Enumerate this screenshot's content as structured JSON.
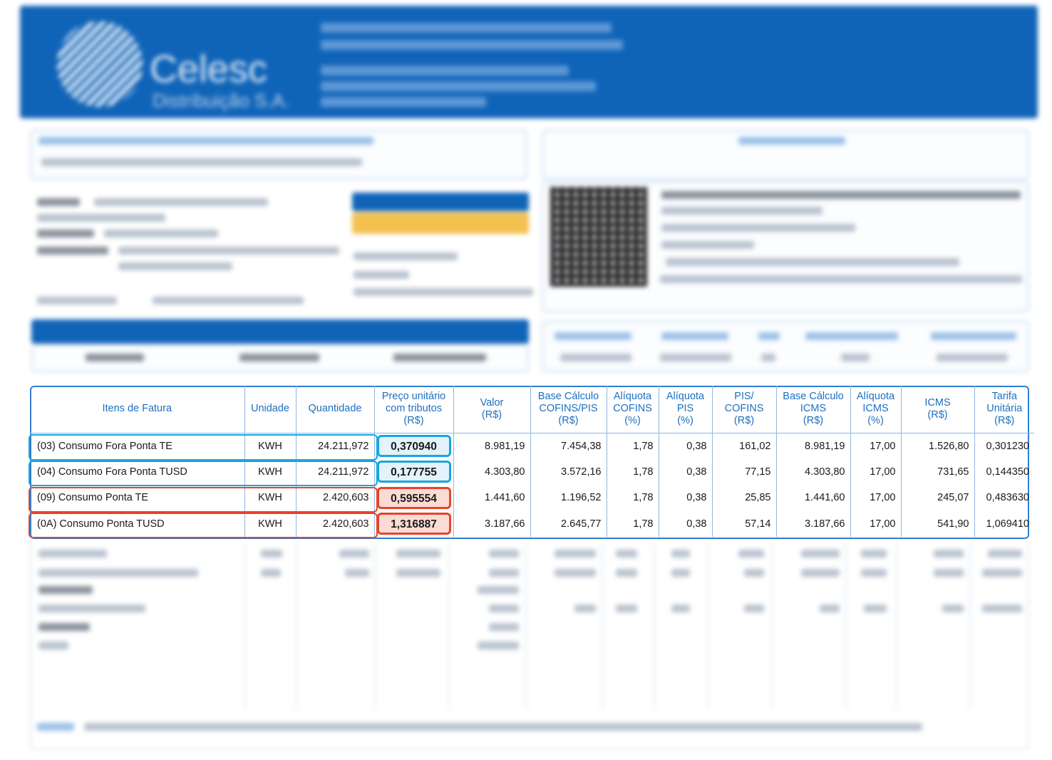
{
  "header": {
    "logo_name": "Celesc",
    "logo_subtitle": "Distribuição S.A."
  },
  "table": {
    "columns": [
      {
        "key": "item",
        "lines": [
          "Itens de Fatura"
        ]
      },
      {
        "key": "unidade",
        "lines": [
          "Unidade"
        ]
      },
      {
        "key": "quantidade",
        "lines": [
          "Quantidade"
        ]
      },
      {
        "key": "preco",
        "lines": [
          "Preço unitário",
          "com tributos",
          "(R$)"
        ]
      },
      {
        "key": "valor",
        "lines": [
          "Valor",
          "(R$)"
        ]
      },
      {
        "key": "base_cofins",
        "lines": [
          "Base Cálculo",
          "COFINS/PIS",
          "(R$)"
        ]
      },
      {
        "key": "aliq_cofins",
        "lines": [
          "Alíquota",
          "COFINS",
          "(%)"
        ]
      },
      {
        "key": "aliq_pis",
        "lines": [
          "Alíquota",
          "PIS",
          "(%)"
        ]
      },
      {
        "key": "pis_cofins",
        "lines": [
          "PIS/",
          "COFINS",
          "(R$)"
        ]
      },
      {
        "key": "base_icms",
        "lines": [
          "Base Cálculo",
          "ICMS",
          "(R$)"
        ]
      },
      {
        "key": "aliq_icms",
        "lines": [
          "Alíquota",
          "ICMS",
          "(%)"
        ]
      },
      {
        "key": "icms",
        "lines": [
          "ICMS",
          "(R$)"
        ]
      },
      {
        "key": "tarifa",
        "lines": [
          "Tarifa",
          "Unitária",
          "(R$)"
        ]
      }
    ],
    "rows": [
      {
        "item": "(03) Consumo Fora Ponta TE",
        "unidade": "KWH",
        "quantidade": "24.211,972",
        "preco": "0,370940",
        "valor": "8.981,19",
        "base_cofins": "7.454,38",
        "aliq_cofins": "1,78",
        "aliq_pis": "0,38",
        "pis_cofins": "161,02",
        "base_icms": "8.981,19",
        "aliq_icms": "17,00",
        "icms": "1.526,80",
        "tarifa": "0,301230",
        "highlight": "blue"
      },
      {
        "item": "(04) Consumo Fora Ponta TUSD",
        "unidade": "KWH",
        "quantidade": "24.211,972",
        "preco": "0,177755",
        "valor": "4.303,80",
        "base_cofins": "3.572,16",
        "aliq_cofins": "1,78",
        "aliq_pis": "0,38",
        "pis_cofins": "77,15",
        "base_icms": "4.303,80",
        "aliq_icms": "17,00",
        "icms": "731,65",
        "tarifa": "0,144350",
        "highlight": "blue"
      },
      {
        "item": "(09) Consumo Ponta TE",
        "unidade": "KWH",
        "quantidade": "2.420,603",
        "preco": "0,595554",
        "valor": "1.441,60",
        "base_cofins": "1.196,52",
        "aliq_cofins": "1,78",
        "aliq_pis": "0,38",
        "pis_cofins": "25,85",
        "base_icms": "1.441,60",
        "aliq_icms": "17,00",
        "icms": "245,07",
        "tarifa": "0,483630",
        "highlight": "red"
      },
      {
        "item": "(0A) Consumo Ponta TUSD",
        "unidade": "KWH",
        "quantidade": "2.420,603",
        "preco": "1,316887",
        "valor": "3.187,66",
        "base_cofins": "2.645,77",
        "aliq_cofins": "1,78",
        "aliq_pis": "0,38",
        "pis_cofins": "57,14",
        "base_icms": "3.187,66",
        "aliq_icms": "17,00",
        "icms": "541,90",
        "tarifa": "1,069410",
        "highlight": "red"
      }
    ]
  },
  "colors": {
    "header_blue": "#1064b8",
    "table_header_text": "#1d6fc0",
    "highlight_blue": "#17a6de",
    "highlight_red": "#e8432b"
  }
}
